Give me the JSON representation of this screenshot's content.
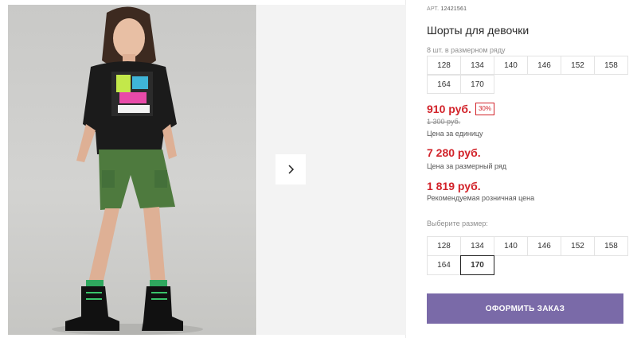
{
  "gallery": {
    "next_icon": "chevron-right-icon"
  },
  "product": {
    "article_label": "АРТ.",
    "article_number": "12421561",
    "title": "Шорты для девочки",
    "pack_label": "8 шт. в размерном ряду",
    "pack_sizes": [
      "128",
      "134",
      "140",
      "146",
      "152",
      "158",
      "164",
      "170"
    ],
    "price": "910 руб.",
    "discount": "30%",
    "old_price": "1 300 руб.",
    "unit_label": "Цена за единицу",
    "size_row_price": "7 280 руб.",
    "size_row_label": "Цена за размерный ряд",
    "rrp_price": "1 819 руб.",
    "rrp_label": "Рекомендуемая розничная цена",
    "choose_size_label": "Выберите размер:",
    "sizes": [
      "128",
      "134",
      "140",
      "146",
      "152",
      "158",
      "164",
      "170"
    ],
    "selected_size": "170",
    "order_button": "ОФОРМИТЬ ЗАКАЗ"
  },
  "colors": {
    "price_red": "#d2232a",
    "button_purple": "#7a6aa8"
  }
}
